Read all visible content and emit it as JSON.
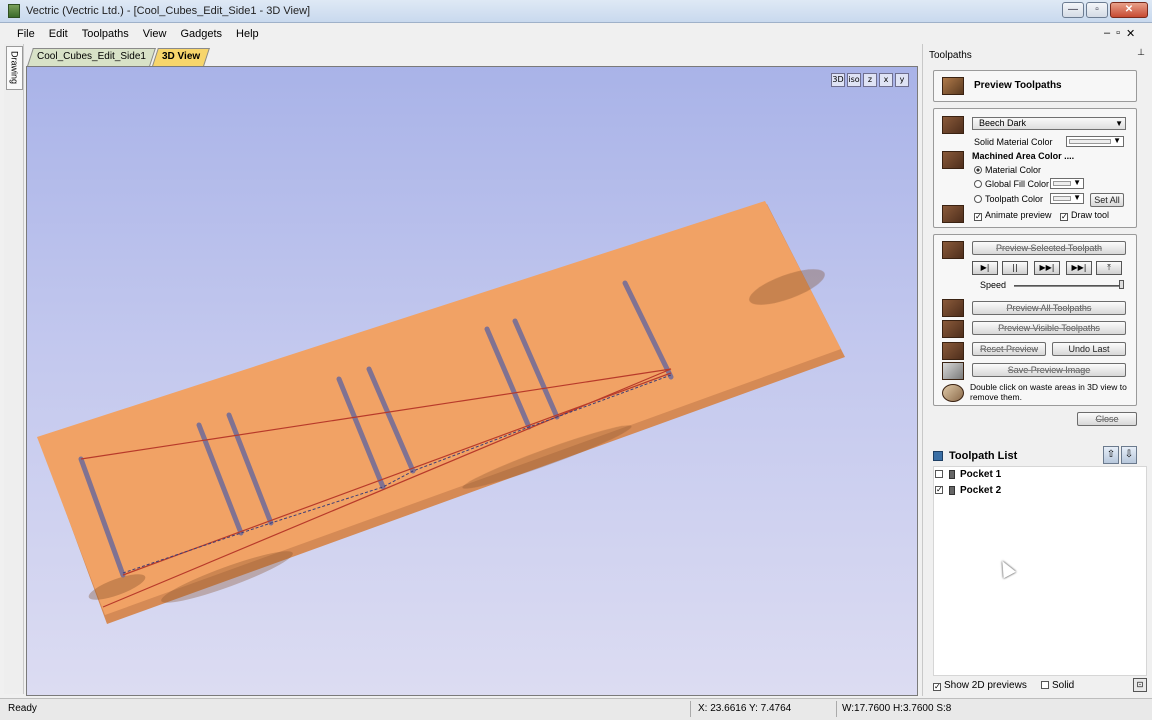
{
  "window": {
    "title": "Vectric (Vectric Ltd.) - [Cool_Cubes_Edit_Side1 - 3D View]",
    "controls": {
      "minimize": "—",
      "maximize": "▫",
      "close": "✕"
    }
  },
  "menu": {
    "items": [
      "File",
      "Edit",
      "Toolpaths",
      "View",
      "Gadgets",
      "Help"
    ],
    "mdi_controls": {
      "minimize": "–",
      "restore": "▫",
      "close": "✕"
    }
  },
  "left_dock": {
    "drawing_tab": "Drawing"
  },
  "doc_tabs": [
    {
      "label": "Cool_Cubes_Edit_Side1",
      "active": false
    },
    {
      "label": "3D View",
      "active": true
    }
  ],
  "viewport": {
    "view_icons": [
      "3D",
      "iso",
      "z",
      "x",
      "y"
    ],
    "background_top": "#a9b3e8",
    "material_color": "#f1a265"
  },
  "panel": {
    "header": "Toolpaths",
    "pin_icon": "pin-icon",
    "preview_title": "Preview Toolpaths",
    "material": {
      "dropdown_value": "Beech Dark",
      "solid_material_label": "Solid Material Color",
      "machined_area_label": "Machined Area Color ....",
      "options": [
        {
          "label": "Material Color",
          "selected": true
        },
        {
          "label": "Global Fill Color",
          "selected": false
        },
        {
          "label": "Toolpath Color",
          "selected": false
        }
      ],
      "set_all": "Set All",
      "animate_preview": "Animate preview",
      "animate_checked": true,
      "draw_tool": "Draw tool",
      "draw_tool_checked": true
    },
    "preview": {
      "preview_selected": "Preview Selected Toolpath",
      "playback": [
        "▶|",
        "||",
        "▶▶|",
        "▶▶|",
        "⤒"
      ],
      "speed_label": "Speed",
      "speed": 1.0,
      "preview_all": "Preview All Toolpaths",
      "preview_visible": "Preview Visible Toolpaths",
      "reset_preview": "Reset Preview",
      "undo_last": "Undo Last",
      "save_preview_image": "Save Preview Image",
      "hint": "Double click on waste areas in 3D view to remove them."
    },
    "close": "Close",
    "toolpath_list": {
      "title": "Toolpath List",
      "items": [
        {
          "label": "Pocket 1",
          "checked": false
        },
        {
          "label": "Pocket 2",
          "checked": true
        }
      ]
    },
    "footer": {
      "show_2d": "Show 2D previews",
      "show_2d_checked": true,
      "solid": "Solid",
      "solid_checked": false
    }
  },
  "status": {
    "ready": "Ready",
    "coords": "X: 23.6616 Y: 7.4764",
    "size": "W:17.7600   H:3.7600  S:8"
  }
}
